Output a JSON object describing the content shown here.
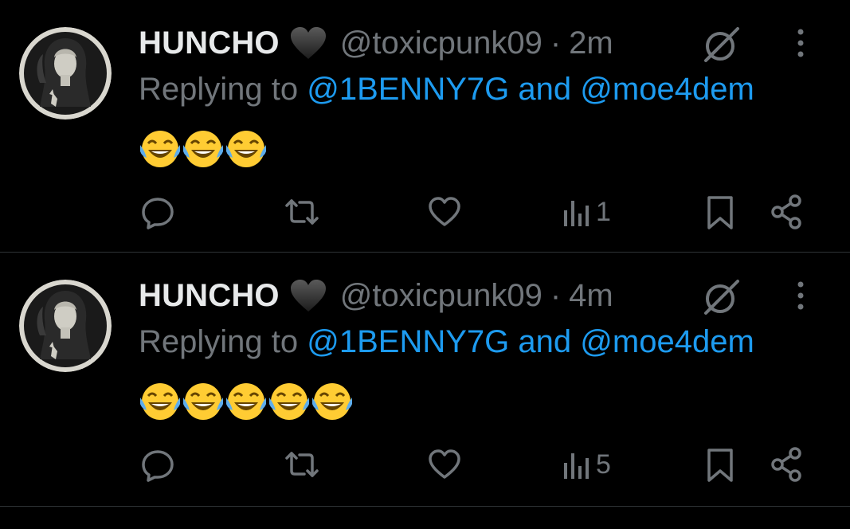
{
  "tweets": [
    {
      "name": "HUNCHO",
      "handle": "@toxicpunk09",
      "separator": "·",
      "time": "2m",
      "replying_prefix": "Replying to",
      "mention_1": "@1BENNY7G",
      "and_word": "and",
      "mention_2": "@moe4dem",
      "emoji_count": 3,
      "views": "1"
    },
    {
      "name": "HUNCHO",
      "handle": "@toxicpunk09",
      "separator": "·",
      "time": "4m",
      "replying_prefix": "Replying to",
      "mention_1": "@1BENNY7G",
      "and_word": "and",
      "mention_2": "@moe4dem",
      "emoji_count": 5,
      "views": "5"
    }
  ],
  "icons": {
    "badge": "black-heart-icon",
    "grok": "grok-icon",
    "more": "more-vertical-icon",
    "reply": "reply-icon",
    "retweet": "retweet-icon",
    "like": "heart-icon",
    "views": "views-icon",
    "bookmark": "bookmark-icon",
    "share": "share-icon",
    "emoji": "face-with-tears-of-joy-emoji"
  },
  "colors": {
    "background": "#000000",
    "text_primary": "#e7e9ea",
    "text_secondary": "#71767b",
    "link": "#1d9bf0",
    "divider": "#2f3336"
  }
}
